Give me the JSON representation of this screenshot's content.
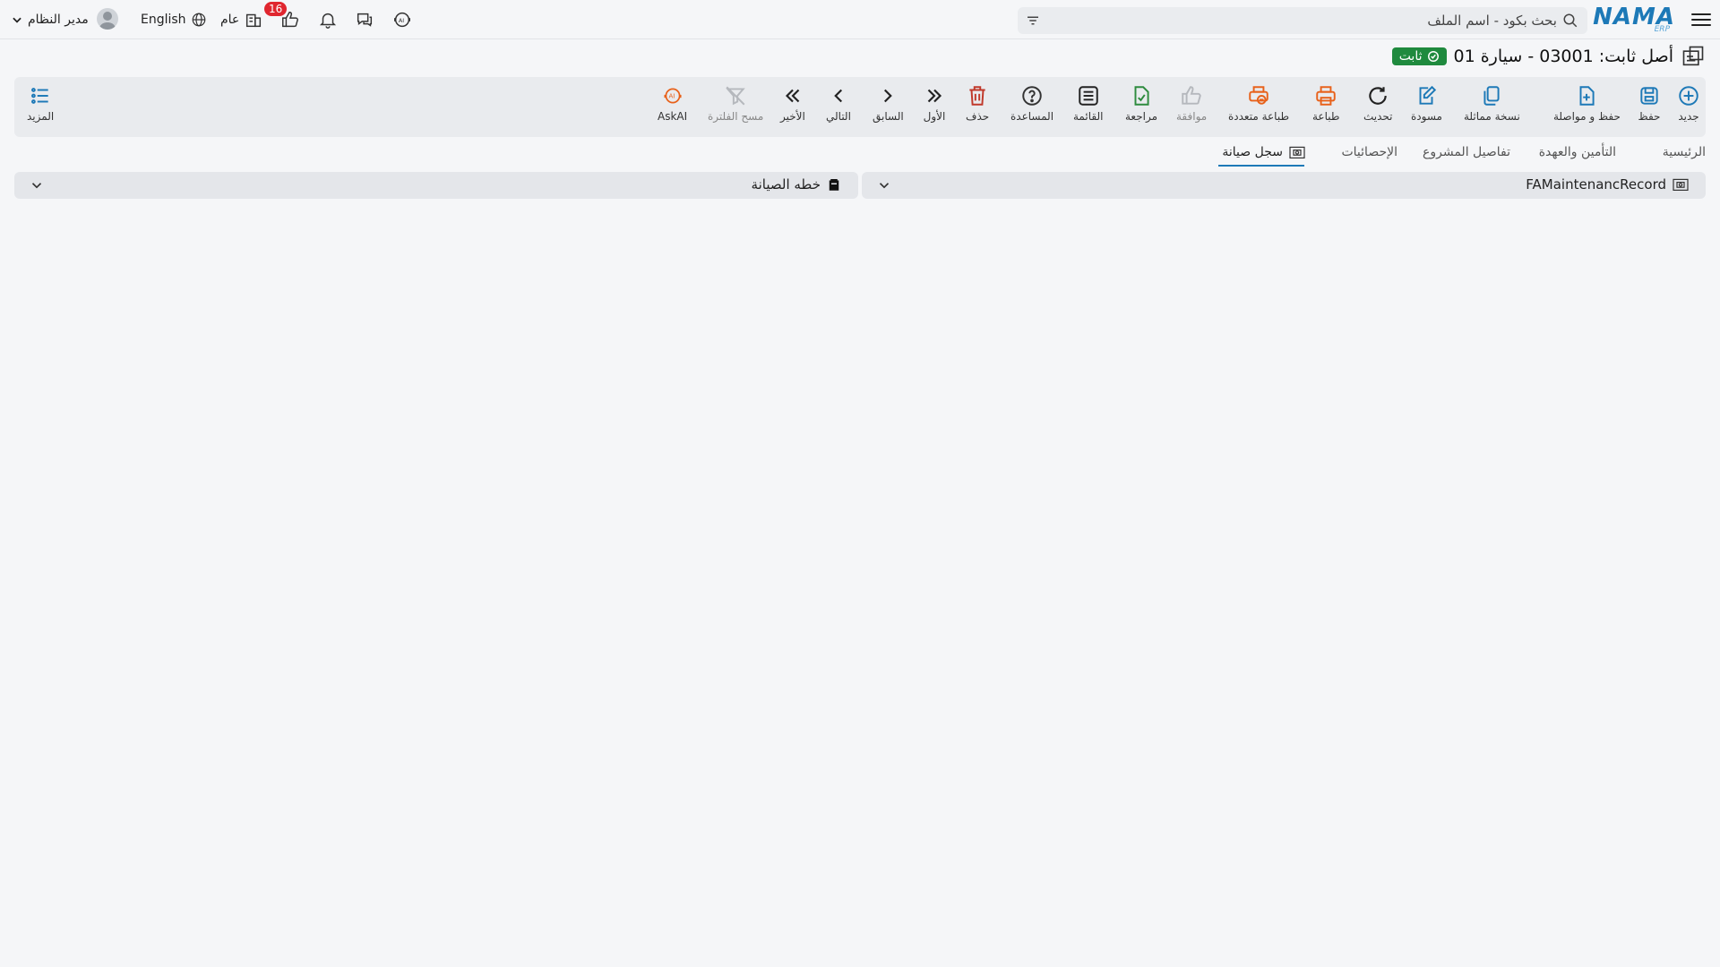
{
  "header": {
    "logo_text": "NAMA",
    "logo_sub": "ERP",
    "search_placeholder": "بحث بكود - اسم الملف",
    "notification_count": "16",
    "branch_label": "عام",
    "language_label": "English",
    "user_name": "مدير النظام"
  },
  "page": {
    "title": "أصل ثابت: 03001 - سيارة 01",
    "status": "ثابت"
  },
  "toolbar": {
    "new": "جديد",
    "save": "حفظ",
    "save_continue": "حفظ و مواصلة",
    "copy": "نسخة مماثلة",
    "draft": "مسودة",
    "refresh": "تحديث",
    "print": "طباعة",
    "multi_print": "طباعة متعددة",
    "approve": "موافقة",
    "review": "مراجعة",
    "list": "القائمة",
    "help": "المساعدة",
    "delete": "حذف",
    "first": "الأول",
    "previous": "السابق",
    "next": "التالي",
    "last": "الأخير",
    "clear_filter": "مسح الفلترة",
    "askai": "AskAI",
    "more": "المزيد"
  },
  "tabs": [
    {
      "label": "الرئيسية"
    },
    {
      "label": "التأمين والعهدة"
    },
    {
      "label": "تفاصيل المشروع"
    },
    {
      "label": "الإحصائيات"
    },
    {
      "label": "سجل صيانة"
    }
  ],
  "panels": {
    "right_title": "FAMaintenancRecord",
    "left_title": "خطه الصيانة"
  },
  "colors": {
    "brand": "#1d79b7",
    "status_green": "#1f8a3e",
    "print_orange": "#e8611a",
    "delete_red": "#c0392b",
    "review_green": "#2e8b3e"
  }
}
